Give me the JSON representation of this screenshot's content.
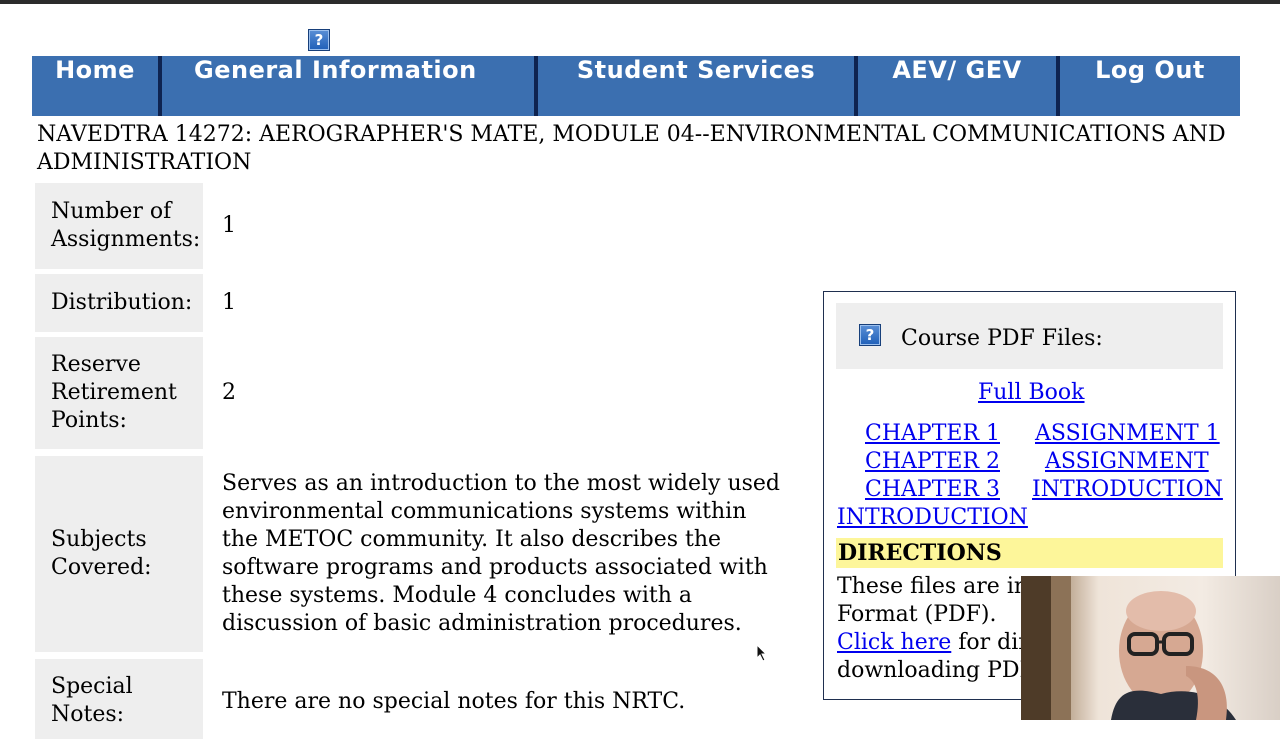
{
  "nav": {
    "items": [
      "Home",
      "General Information",
      "Student Services",
      "AEV/ GEV",
      "Log Out"
    ]
  },
  "course": {
    "title": "NAVEDTRA 14272: AEROGRAPHER'S MATE, MODULE 04--ENVIRONMENTAL COMMUNICATIONS AND ADMINISTRATION"
  },
  "details": {
    "assignments_label": "Number of Assignments:",
    "assignments_value": "1",
    "distribution_label": "Distribution:",
    "distribution_value": "1",
    "retirement_label": "Reserve Retirement Points:",
    "retirement_value": "2",
    "subjects_label": "Subjects Covered:",
    "subjects_value": "Serves as an introduction to the most widely used environmental communications systems within the METOC community. It also describes the software programs and products associated with these systems. Module 4 concludes with a discussion of basic administration procedures.",
    "notes_label": "Special Notes:",
    "notes_value": "There are no special notes for this NRTC."
  },
  "pdf": {
    "header": "Course PDF Files:",
    "full_book": "Full Book",
    "chapter1": "CHAPTER 1",
    "chapter2": "CHAPTER 2",
    "chapter3": "CHAPTER 3",
    "assignment1": "ASSIGNMENT 1",
    "assignment_intro_1": "ASSIGNMENT",
    "assignment_intro_2": "INTRODUCTION",
    "introduction": "INTRODUCTION",
    "directions_title": "DIRECTIONS",
    "directions_line1": "These files are in",
    "directions_line2": "Format (PDF).",
    "click_here": "Click here",
    "directions_line3_rest": " for dire",
    "directions_line4": "downloading PDF"
  },
  "icons": {
    "help_glyph": "?"
  },
  "colors": {
    "nav_bg": "#3b6fb0",
    "nav_separator": "#0e2350",
    "label_bg": "#eeeeee",
    "directions_bg": "#fdf69a",
    "link": "#0000ee"
  }
}
